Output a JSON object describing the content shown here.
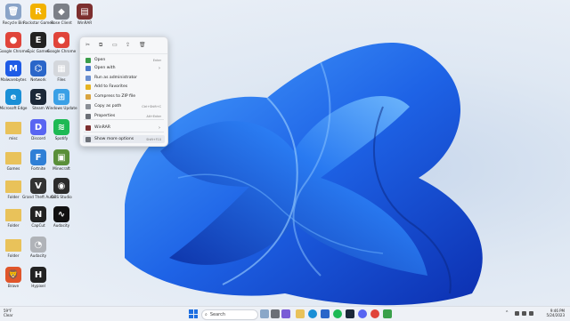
{
  "desktop_icons": [
    {
      "label": "Recycle Bin",
      "color": "#8aa4c8",
      "glyph": "🗑"
    },
    {
      "label": "Rockstar Games",
      "color": "#f2b200",
      "glyph": "R"
    },
    {
      "label": "Rose Client",
      "color": "#7b7f87",
      "glyph": "◆"
    },
    {
      "label": "WinRAR",
      "color": "#7d2f2f",
      "glyph": "▤"
    },
    {
      "label": "Google Chrome",
      "color": "#e0443a",
      "glyph": "●"
    },
    {
      "label": "Epic Games",
      "color": "#222222",
      "glyph": "E"
    },
    {
      "label": "Google Chrome",
      "color": "#e0443a",
      "glyph": "●"
    },
    {
      "label": "Malwarebytes",
      "color": "#1e5be6",
      "glyph": "M"
    },
    {
      "label": "Network",
      "color": "#2a66c9",
      "glyph": "⌬"
    },
    {
      "label": "Files",
      "color": "#d4d7dc",
      "glyph": "▦"
    },
    {
      "label": "Microsoft Edge",
      "color": "#1a8fd6",
      "glyph": "e"
    },
    {
      "label": "Steam",
      "color": "#1b2838",
      "glyph": "S"
    },
    {
      "label": "Windows Update",
      "color": "#3aa0e6",
      "glyph": "⊞"
    },
    {
      "label": "misc",
      "color": "#e9c25a",
      "glyph": ""
    },
    {
      "label": "Discord",
      "color": "#5865f2",
      "glyph": "D"
    },
    {
      "label": "Spotify",
      "color": "#1db954",
      "glyph": "≋"
    },
    {
      "label": "Games",
      "color": "#e9c25a",
      "glyph": ""
    },
    {
      "label": "Fortnite",
      "color": "#2f7fd6",
      "glyph": "F"
    },
    {
      "label": "Minecraft",
      "color": "#5a8f3a",
      "glyph": "▣"
    },
    {
      "label": "Folder",
      "color": "#e9c25a",
      "glyph": ""
    },
    {
      "label": "Grand Theft Auto V",
      "color": "#333333",
      "glyph": "V"
    },
    {
      "label": "OBS Studio",
      "color": "#2b2b2b",
      "glyph": "◉"
    },
    {
      "label": "Folder",
      "color": "#e9c25a",
      "glyph": ""
    },
    {
      "label": "CapCut",
      "color": "#222222",
      "glyph": "N"
    },
    {
      "label": "Audacity",
      "color": "#111111",
      "glyph": "∿"
    },
    {
      "label": "Folder",
      "color": "#e9c25a",
      "glyph": ""
    },
    {
      "label": "Audacity",
      "color": "#b0b3b8",
      "glyph": "◔"
    },
    {
      "label": "Brave",
      "color": "#e0552a",
      "glyph": "🦁"
    },
    {
      "label": "Hypixel",
      "color": "#222222",
      "glyph": "H"
    }
  ],
  "context_menu": {
    "items": [
      {
        "label": "Open",
        "shortcut": "Enter",
        "icon_color": "#3a9d4a",
        "arrow": ""
      },
      {
        "label": "Open with",
        "shortcut": "",
        "icon_color": "#4a79c9",
        "arrow": "›"
      },
      {
        "label": "Run as administrator",
        "shortcut": "",
        "icon_color": "#6a8fd0",
        "arrow": ""
      },
      {
        "label": "Add to Favorites",
        "shortcut": "",
        "icon_color": "#e6b422",
        "arrow": ""
      },
      {
        "label": "Compress to ZIP file",
        "shortcut": "",
        "icon_color": "#d9a441",
        "arrow": ""
      },
      {
        "label": "Copy as path",
        "shortcut": "Ctrl+Shift+C",
        "icon_color": "#8b8f96",
        "arrow": ""
      },
      {
        "label": "Properties",
        "shortcut": "Alt+Enter",
        "icon_color": "#6b6f76",
        "arrow": ""
      },
      {
        "label": "WinRAR",
        "shortcut": "",
        "icon_color": "#7d2f2f",
        "arrow": "›"
      },
      {
        "label": "Show more options",
        "shortcut": "Shift+F10",
        "icon_color": "#6b6f76",
        "arrow": ""
      }
    ]
  },
  "taskbar": {
    "weather_temp": "59°F",
    "weather_desc": "Clear",
    "search_placeholder": "Search",
    "time": "9:46 PM",
    "date": "5/24/2023"
  }
}
